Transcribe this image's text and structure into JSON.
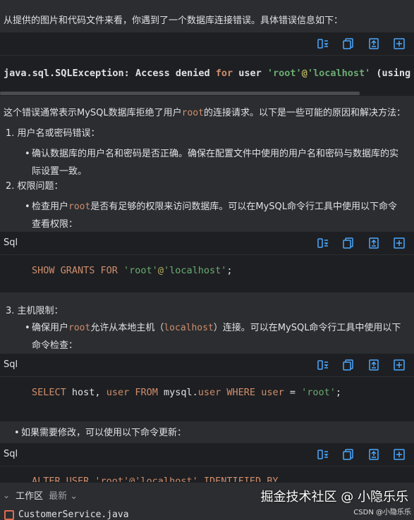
{
  "intro": "从提供的图片和代码文件来看，你遇到了一个数据库连接错误。具体错误信息如下：",
  "error_code": {
    "exception": "java.sql.SQLException:",
    "text1": " Access denied ",
    "kw_for": "for",
    "text2": " user ",
    "user_str": "'root'",
    "at": "@",
    "host_str": "'localhost'",
    "text3": " (using p"
  },
  "summary": {
    "before": "这个错误通常表示MySQL数据库拒绝了用户",
    "root": "root",
    "after": "的连接请求。以下是一些可能的原因和解决方法："
  },
  "item1": {
    "heading": "1. 用户名或密码错误：",
    "bullet": "确认数据库的用户名和密码是否正确。确保在配置文件中使用的用户名和密码与数据库的实际设置一致。"
  },
  "item2": {
    "heading": "2. 权限问题：",
    "bullet_a": "检查用户",
    "root": "root",
    "bullet_b": "是否有足够的权限来访问数据库。可以在MySQL命令行工具中使用以下命令查看权限："
  },
  "code1": {
    "lang": "Sql",
    "kw1": "SHOW GRANTS FOR ",
    "s1": "'root'",
    "at": "@",
    "s2": "'localhost'",
    "end": ";"
  },
  "item3": {
    "heading": "3. 主机限制：",
    "bullet_a": "确保用户",
    "root": "root",
    "bullet_b": "允许从本地主机（",
    "localhost": "localhost",
    "bullet_c": "）连接。可以在MySQL命令行工具中使用以下命令检查："
  },
  "code2": {
    "lang": "Sql",
    "kw1": "SELECT",
    "t1": " host, ",
    "kw2": "user",
    "t2": " ",
    "kw3": "FROM",
    "t3": " mysql.",
    "kw4": "user",
    "t4": " ",
    "kw5": "WHERE",
    "t5": " ",
    "kw6": "user",
    "t6": " = ",
    "s1": "'root'",
    "end": ";"
  },
  "item4": {
    "bullet": "如果需要修改，可以使用以下命令更新："
  },
  "code3": {
    "lang": "Sql",
    "partial": "ALTER USER 'root'@'localhost' IDENTIFIED BY"
  },
  "bottom": {
    "workspace": "工作区",
    "recent": "最新",
    "file": "CustomerService.java",
    "watermark": "掘金技术社区 @ 小隐乐乐",
    "csdn": "CSDN @小隐乐乐"
  },
  "icons": [
    "toggle-wrap-icon",
    "copy-icon",
    "insert-icon",
    "new-file-icon"
  ]
}
